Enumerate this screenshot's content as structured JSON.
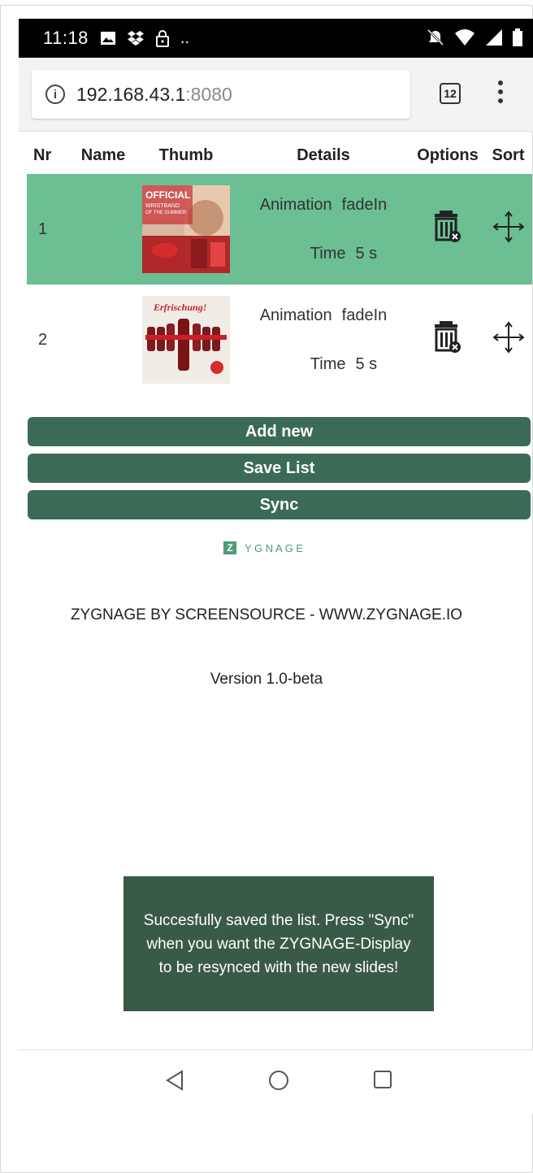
{
  "status_bar": {
    "time": "11:18",
    "more": ".."
  },
  "browser": {
    "url_host": "192.168.43.1",
    "url_port": ":8080",
    "tab_count": "12"
  },
  "table": {
    "headers": [
      "Nr",
      "Name",
      "Thumb",
      "Details",
      "Options",
      "Sort"
    ],
    "rows": [
      {
        "nr": "1",
        "name": "",
        "animation_label": "Animation",
        "animation": "fadeIn",
        "time_label": "Time",
        "time": "5 s",
        "thumb_text": "OFFICIAL",
        "thumb_sub": "WRISTBAND OF THE SUMMER",
        "selected": true
      },
      {
        "nr": "2",
        "name": "",
        "animation_label": "Animation",
        "animation": "fadeIn",
        "time_label": "Time",
        "time": "5 s",
        "thumb_text": "Erfrischung!",
        "selected": false
      }
    ]
  },
  "buttons": {
    "add": "Add new",
    "save": "Save List",
    "sync": "Sync"
  },
  "logo": {
    "letter": "Z",
    "rest": "Y G N A G E"
  },
  "footer": {
    "credit": "ZYGNAGE BY SCREENSOURCE - WWW.ZYGNAGE.IO",
    "version": "Version 1.0-beta"
  },
  "toast": {
    "message": "Succesfully saved the list. Press \"Sync\" when you want the ZYGNAGE-Display to be resynced with the new slides!"
  },
  "colors": {
    "selected_row": "#6bbf93",
    "button": "#3b6b56",
    "toast": "#3a5a48",
    "brand": "#4f9c74"
  }
}
